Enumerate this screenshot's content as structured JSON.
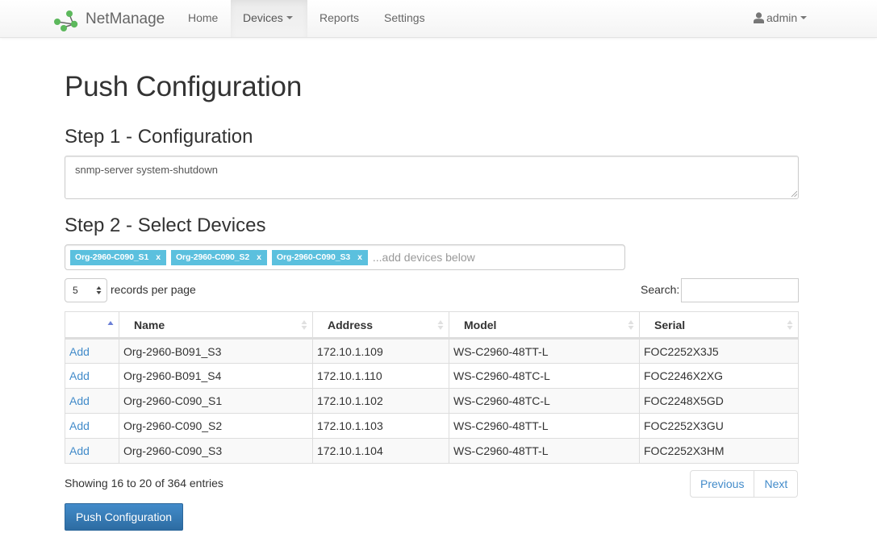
{
  "navbar": {
    "brand": "NetManage",
    "items": [
      {
        "label": "Home"
      },
      {
        "label": "Devices",
        "active": true,
        "dropdown": true
      },
      {
        "label": "Reports"
      },
      {
        "label": "Settings"
      }
    ],
    "user": {
      "label": "admin",
      "icon": "user-icon"
    },
    "brand_color": "#5cb85c"
  },
  "page": {
    "title": "Push Configuration"
  },
  "step1": {
    "title": "Step 1 - Configuration",
    "config_value": "snmp-server system-shutdown"
  },
  "step2": {
    "title": "Step 2 - Select Devices",
    "selected_tags": [
      {
        "label": "Org-2960-C090_S1",
        "remove": "x"
      },
      {
        "label": "Org-2960-C090_S2",
        "remove": "x"
      },
      {
        "label": "Org-2960-C090_S3",
        "remove": "x"
      }
    ],
    "tags_placeholder": "...add devices below",
    "tag_color": "#5bc0de"
  },
  "table_controls": {
    "page_length": "5",
    "page_length_label": "records per page",
    "search_label": "Search:",
    "search_value": ""
  },
  "table": {
    "columns": [
      {
        "label": ""
      },
      {
        "label": "Name"
      },
      {
        "label": "Address"
      },
      {
        "label": "Model"
      },
      {
        "label": "Serial"
      }
    ],
    "rows": [
      {
        "action": "Add",
        "name": "Org-2960-B091_S3",
        "address": "172.10.1.109",
        "model": "WS-C2960-48TT-L",
        "serial": "FOC2252X3J5"
      },
      {
        "action": "Add",
        "name": "Org-2960-B091_S4",
        "address": "172.10.1.110",
        "model": "WS-C2960-48TC-L",
        "serial": "FOC2246X2XG"
      },
      {
        "action": "Add",
        "name": "Org-2960-C090_S1",
        "address": "172.10.1.102",
        "model": "WS-C2960-48TC-L",
        "serial": "FOC2248X5GD"
      },
      {
        "action": "Add",
        "name": "Org-2960-C090_S2",
        "address": "172.10.1.103",
        "model": "WS-C2960-48TT-L",
        "serial": "FOC2252X3GU"
      },
      {
        "action": "Add",
        "name": "Org-2960-C090_S3",
        "address": "172.10.1.104",
        "model": "WS-C2960-48TT-L",
        "serial": "FOC2252X3HM"
      }
    ]
  },
  "footer": {
    "info": "Showing 16 to 20 of 364 entries",
    "previous": "Previous",
    "next": "Next",
    "push_button": "Push Configuration",
    "link_color": "#428bca"
  }
}
